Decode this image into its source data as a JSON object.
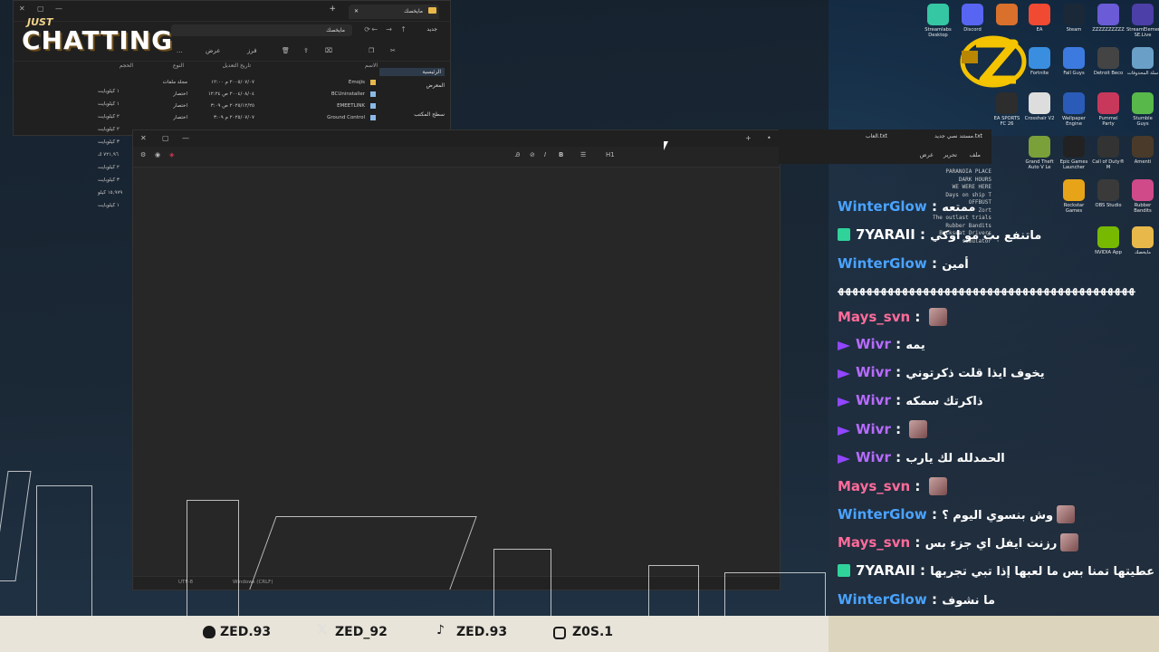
{
  "overlay": {
    "title_small": "JUST",
    "title_main": "CHATTING"
  },
  "explorer": {
    "tab_title": "مايخصك",
    "address": "مايخصك",
    "new_button": "جديد",
    "toolbar": {
      "sort": "فرز",
      "view": "عرض",
      "more": "..."
    },
    "sidebar": [
      "الرئيسية",
      "المعرض",
      "سطح المكتب"
    ],
    "columns": {
      "name": "الاسم",
      "modified": "تاريخ التعديل",
      "type": "النوع",
      "size": "الحجم"
    },
    "rows": [
      {
        "name": "Emojis",
        "modified": "٢٠٠٥/٠٧/٠٧ م ١٢:٠٠",
        "type": "مجلد ملفات",
        "folder": true
      },
      {
        "name": "BCUninstaller",
        "modified": "٢٠٠٤/٠٨/٠٤ ص ١٢:٢٤",
        "type": "اختصار",
        "folder": false
      },
      {
        "name": "EMEETLINK",
        "modified": "٢٠٢٥/١٢/٢٥ ص ٣:٠٩",
        "type": "اختصار",
        "folder": false
      },
      {
        "name": "Ground Control",
        "modified": "٢٠٢٥/٠٧/٠٧ م ٣:٠٩",
        "type": "اختصار",
        "folder": false
      }
    ],
    "sizes": [
      "١ كيلوبايت",
      "١ كيلوبايت",
      "٢ كيلوبايت",
      "٢ كيلوبايت",
      "٣ كيلوبايت",
      "٧٢١,٩٦ ك",
      "٢ كيلوبايت",
      "٣ كيلوبايت",
      "١٥,٩٧٩ كيلو",
      "١ كيلوبايت"
    ]
  },
  "notepad": {
    "status_encoding": "UTF-8",
    "status_eol": "Windows (CRLF)",
    "status_zoom": "",
    "heading_btn": "H1"
  },
  "notepad2": {
    "tab1": "مستند نصي جديد.txt",
    "tab2": "العاب.txt",
    "menu": [
      "ملف",
      "تحرير",
      "عرض"
    ],
    "lines": [
      "PARANOIA PLACE",
      "DARK HOURS",
      "WE WERE HERE",
      "Days on ship T",
      "OFFBUST",
      "Zort",
      "The outlast trials",
      "Rubber Bandits",
      "Backseat Drivers",
      "simulator"
    ]
  },
  "desktop_icons": [
    {
      "label": "Streamlabs Desktop",
      "color": "#35c6a3"
    },
    {
      "label": "Discord",
      "color": "#5865f2"
    },
    {
      "label": "",
      "color": "#d9702c"
    },
    {
      "label": "EA",
      "color": "#f04a33"
    },
    {
      "label": "Steam",
      "color": "#1b2838"
    },
    {
      "label": "ZZZZZZZZZZ",
      "color": "#6b5bd6"
    },
    {
      "label": "StreamElements SE.Live",
      "color": "#4c3fa8"
    },
    {
      "label": "Fortnite",
      "color": "#3a8ee0"
    },
    {
      "label": "Fall Guys",
      "color": "#3d7ae0"
    },
    {
      "label": "Detroit Beco",
      "color": "#444"
    },
    {
      "label": "سلة المحذوفات",
      "color": "#6aa0c8"
    },
    {
      "label": "EA SPORTS FC 26",
      "color": "#2d2d2d"
    },
    {
      "label": "Crosshair V2",
      "color": "#ddd"
    },
    {
      "label": "Wallpaper Engine",
      "color": "#2a5bb8"
    },
    {
      "label": "Pummel Party",
      "color": "#c8385a"
    },
    {
      "label": "Stumble Guys",
      "color": "#59b84a"
    },
    {
      "label": "Grand Theft Auto V Le",
      "color": "#7aa03a"
    },
    {
      "label": "Epic Games Launcher",
      "color": "#222"
    },
    {
      "label": "Call of Duty® M",
      "color": "#333"
    },
    {
      "label": "Amenti",
      "color": "#4a3a2a"
    },
    {
      "label": "Rockstar Games",
      "color": "#e8a418"
    },
    {
      "label": "OBS Studio",
      "color": "#3a3a3a"
    },
    {
      "label": "Rubber Bandits",
      "color": "#d04a8a"
    },
    {
      "label": "NVIDIA App",
      "color": "#76b900"
    },
    {
      "label": "مايخصك",
      "color": "#e8b84a"
    }
  ],
  "chat": {
    "spam_line": "ﻬﻬﻬﻬﻬﻬﻬﻬﻬﻬﻬﻬﻬﻬﻬﻬﻬﻬﻬﻬﻬﻬﻬﻬﻬﻬﻬﻬﻬﻬﻬﻬﻬﻬﻬﻬﻬﻬﻬﻬﻬﻬ",
    "messages": [
      {
        "user": "WinterGlow",
        "color": "#4aa3ff",
        "text": "ممتعه"
      },
      {
        "user": "7YARAII",
        "color": "#ffffff",
        "text": "ماتنفع بث مو اوكي",
        "badge": true
      },
      {
        "user": "WinterGlow",
        "color": "#4aa3ff",
        "text": "أمين"
      },
      {
        "user": "Mays_svn",
        "color": "#ff6b9a",
        "text": "",
        "emote": true
      },
      {
        "user": "Wivr",
        "color": "#b86bff",
        "text": "يمه",
        "prime": true
      },
      {
        "user": "Wivr",
        "color": "#b86bff",
        "text": "يخوف ايذا قلت ذكرتوني",
        "prime": true
      },
      {
        "user": "Wivr",
        "color": "#b86bff",
        "text": "ذاكرتك سمكه",
        "prime": true
      },
      {
        "user": "Wivr",
        "color": "#b86bff",
        "text": "",
        "prime": true,
        "emote": true
      },
      {
        "user": "Wivr",
        "color": "#b86bff",
        "text": "الحمدلله لك يارب",
        "prime": true
      },
      {
        "user": "Mays_svn",
        "color": "#ff6b9a",
        "text": "",
        "emote": true
      },
      {
        "user": "WinterGlow",
        "color": "#4aa3ff",
        "text": "وش بنسوي اليوم ؟",
        "emote": true
      },
      {
        "user": "Mays_svn",
        "color": "#ff6b9a",
        "text": "رزنت ايفل اي جزء بس",
        "emote": true
      },
      {
        "user": "7YARAII",
        "color": "#ffffff",
        "text": "لعب عطيتها تمنا بس ما لعبها إذا تبي تجربها",
        "badge": true
      },
      {
        "user": "WinterGlow",
        "color": "#4aa3ff",
        "text": "ما نشوف"
      }
    ]
  },
  "socials": [
    {
      "icon": "snapchat-icon",
      "handle": "ZED.93"
    },
    {
      "icon": "x-icon",
      "handle": "ZED_92"
    },
    {
      "icon": "tiktok-icon",
      "handle": "ZED.93"
    },
    {
      "icon": "instagram-icon",
      "handle": "Z0S.1"
    }
  ]
}
